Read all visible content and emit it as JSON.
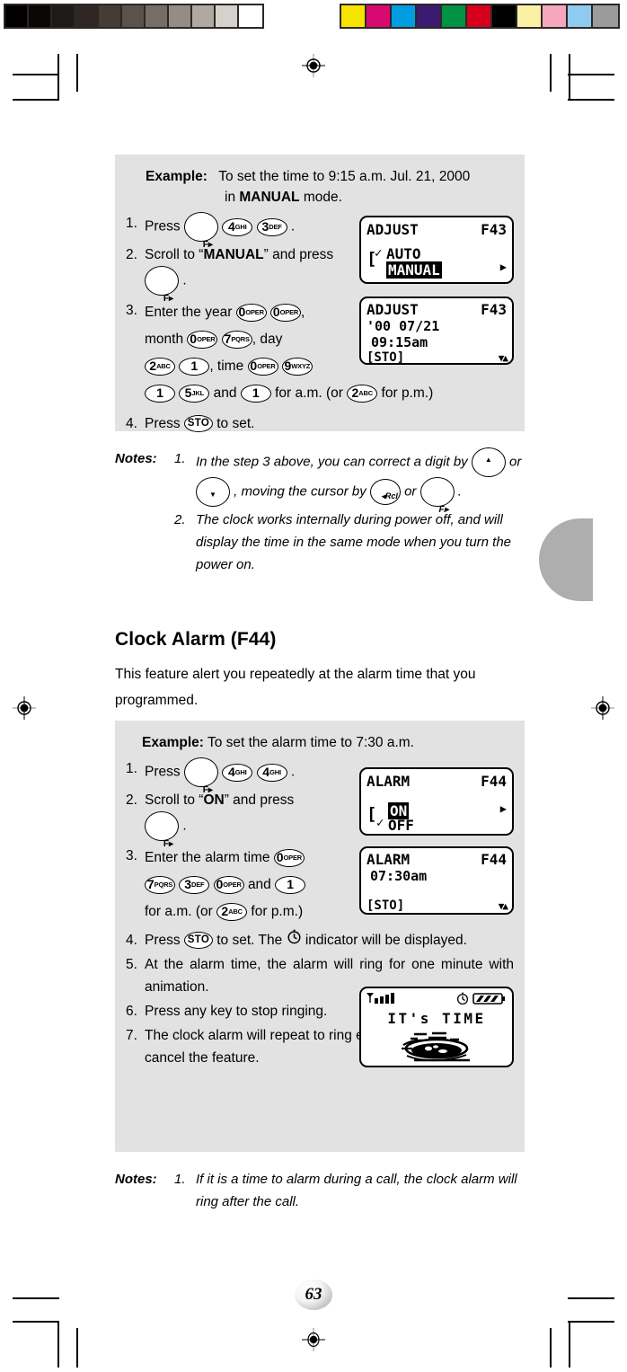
{
  "calibration": {
    "gray_strip": [
      "#000000",
      "#0b0707",
      "#1d1a18",
      "#2e2724",
      "#453c37",
      "#5a524c",
      "#756e68",
      "#948c86",
      "#b0a9a3",
      "#d5d1cd",
      "#ffffff"
    ],
    "color_strip": [
      "#f5e400",
      "#d80a71",
      "#009ee0",
      "#3b1a70",
      "#009245",
      "#d6001c",
      "#000000",
      "#fbf1a4",
      "#f4a7bf",
      "#8fcbf0",
      "#9b9b9b"
    ]
  },
  "example1": {
    "label": "Example:",
    "headline": "To set the time to 9:15 a.m. Jul. 21, 2000",
    "headline2_pre": "in ",
    "headline2_bold": "MANUAL",
    "headline2_post": " mode.",
    "steps": [
      {
        "num": "1.",
        "text_before": "Press",
        "text_after": "."
      },
      {
        "num": "2.",
        "text_a": "Scroll to “",
        "bold": "MANUAL",
        "text_b": "” and press",
        "text_c": "."
      },
      {
        "num": "3.",
        "t1": "Enter the year",
        "t2": ",",
        "t3": "month",
        "t4": ", day",
        "t5": ", time",
        "t6": "and",
        "t7": "for a.m. (or",
        "t8": "for p.m.)"
      },
      {
        "num": "4.",
        "text_before": "Press",
        "text_after": "to set."
      }
    ],
    "keys": {
      "f": "F▸",
      "four": "4",
      "four_sub": "GHI",
      "three": "3",
      "three_sub": "DEF",
      "zero": "0",
      "zero_sub": "OPER",
      "seven": "7",
      "seven_sub": "PQRS",
      "two": "2",
      "two_sub": "ABC",
      "one": "1",
      "one_sub": "",
      "nine": "9",
      "nine_sub": "WXYZ",
      "five": "5",
      "five_sub": "JKL",
      "sto": "STO"
    },
    "lcd1": {
      "title": "ADJUST",
      "code": "F43",
      "line_auto": "AUTO",
      "line_manual": "MANUAL",
      "bracket": "[",
      "check": "✓",
      "arrow": "▶"
    },
    "lcd2": {
      "title": "ADJUST",
      "code": "F43",
      "date": "'00 07/21",
      "time": "09:15am",
      "status": "[STO]",
      "indicator": "▼▲"
    }
  },
  "notes1": {
    "label": "Notes:",
    "items": [
      {
        "num": "1.",
        "a": "In the step 3 above, you can correct a digit by",
        "b": "or",
        "c": ", moving the cursor by",
        "d": "or",
        "e": "."
      },
      {
        "num": "2.",
        "text": "The clock works internally during power off, and will display the time in the same mode when you turn the power on."
      }
    ]
  },
  "section": {
    "title": "Clock Alarm (F44)",
    "intro": "This feature alert you repeatedly at the alarm time that you programmed."
  },
  "example2": {
    "label": "Example:",
    "headline": "To set the alarm time to 7:30 a.m.",
    "steps": [
      {
        "num": "1.",
        "text_before": "Press",
        "text_after": "."
      },
      {
        "num": "2.",
        "text_a": "Scroll to “",
        "bold": "ON",
        "text_b": "” and press",
        "text_c": "."
      },
      {
        "num": "3.",
        "t1": "Enter the alarm time",
        "t2": "and",
        "t3": "for a.m. (or",
        "t4": "for p.m.)"
      },
      {
        "num": "4.",
        "a": "Press",
        "b": "to set. The",
        "c": "indicator will be displayed."
      },
      {
        "num": "5.",
        "text": "At the alarm time, the alarm will ring for one minute with animation."
      },
      {
        "num": "6.",
        "text": "Press any key to stop ringing."
      },
      {
        "num": "7.",
        "text": "The clock alarm will repeat to ring every day until you cancel the feature."
      }
    ],
    "lcd1": {
      "title": "ALARM",
      "code": "F44",
      "line_on": "ON",
      "line_off": "OFF",
      "bracket": "[",
      "check": "✓",
      "arrow": "▶"
    },
    "lcd2": {
      "title": "ALARM",
      "code": "F44",
      "time": "07:30am",
      "status": "[STO]",
      "indicator": "▼▲"
    },
    "lcd3": {
      "text": "IT's TIME",
      "signal": "signal-bars",
      "clock": "clock-icon",
      "battery": "battery-icon"
    }
  },
  "notes2": {
    "label": "Notes:",
    "items": [
      {
        "num": "1.",
        "text": "If it is a time to alarm during a call, the clock alarm will ring after the call."
      }
    ]
  },
  "page_number": "63"
}
